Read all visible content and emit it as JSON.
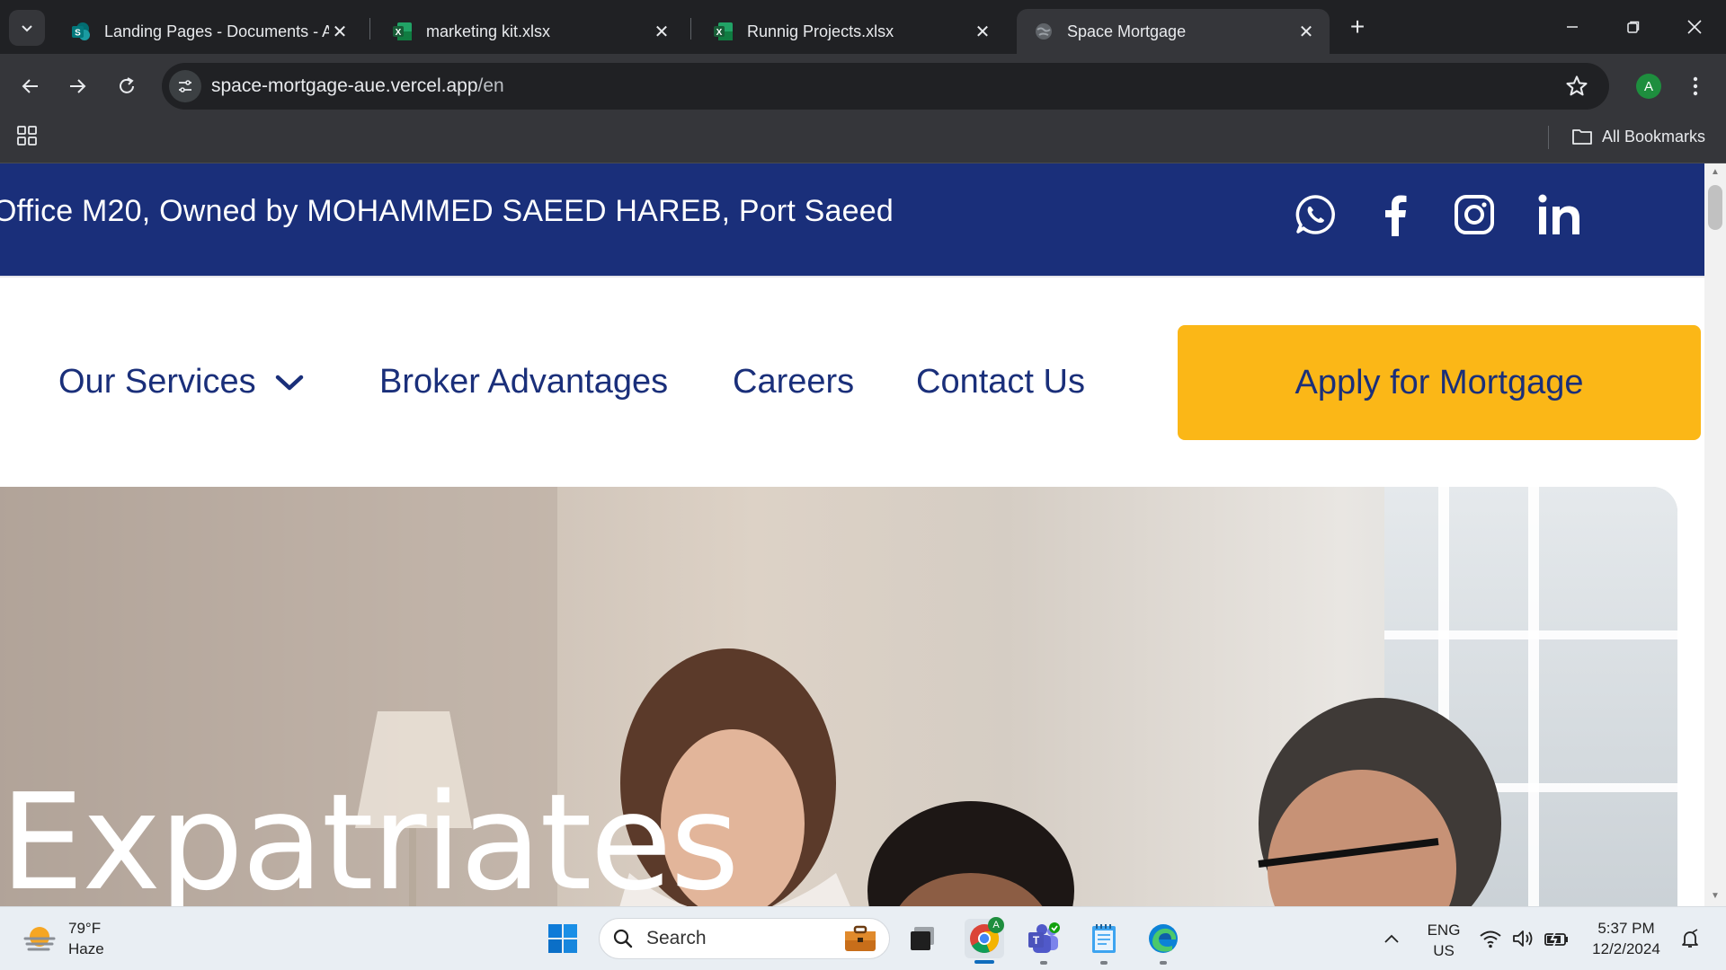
{
  "browser": {
    "tabs": [
      {
        "title": "Landing Pages - Documents - A",
        "icon": "sharepoint-icon"
      },
      {
        "title": "marketing kit.xlsx",
        "icon": "excel-icon"
      },
      {
        "title": "Runnig Projects.xlsx",
        "icon": "excel-icon"
      },
      {
        "title": "Space Mortgage",
        "icon": "globe-icon",
        "active": true
      }
    ],
    "url_host": "space-mortgage-aue.vercel.app",
    "url_path": "/en",
    "profile_initial": "A",
    "bookmarks_label": "All Bookmarks"
  },
  "site": {
    "colors": {
      "primary": "#1a2f7a",
      "accent": "#fbb717"
    },
    "topbar_address": "Office M20, Owned by MOHAMMED SAEED HAREB, Port Saeed",
    "social": [
      "whatsapp-icon",
      "facebook-icon",
      "instagram-icon",
      "linkedin-icon"
    ],
    "nav": {
      "services": "Our Services",
      "broker": "Broker Advantages",
      "careers": "Careers",
      "contact": "Contact Us",
      "apply": "Apply for Mortgage"
    },
    "hero_title": "Expatriates"
  },
  "taskbar": {
    "weather_temp": "79°F",
    "weather_desc": "Haze",
    "search_label": "Search",
    "lang_line1": "ENG",
    "lang_line2": "US",
    "time": "5:37 PM",
    "date": "12/2/2024"
  }
}
